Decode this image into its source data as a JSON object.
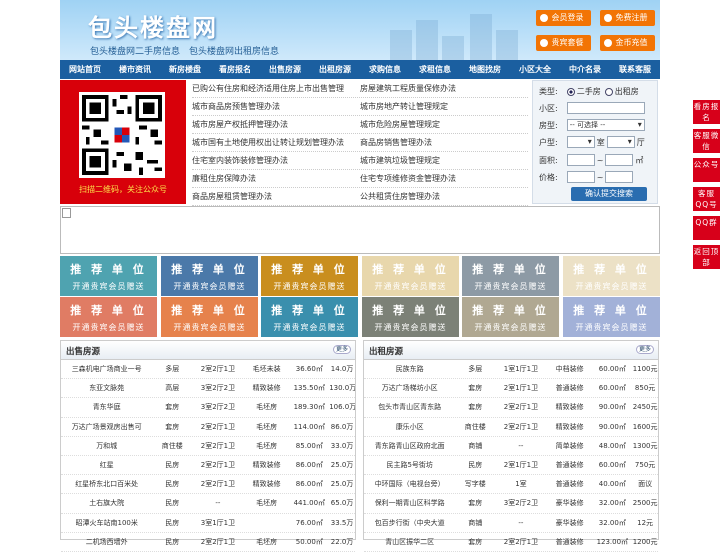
{
  "header": {
    "title": "包头楼盘网",
    "subtitle": "包头楼盘网二手房信息　包头楼盘网出租房信息",
    "buttons": [
      {
        "label": "会员登录"
      },
      {
        "label": "免费注册"
      },
      {
        "label": "贵宾套餐"
      },
      {
        "label": "金币充值"
      }
    ]
  },
  "nav": [
    "网站首页",
    "楼市资讯",
    "新房楼盘",
    "看房报名",
    "出售房源",
    "出租房源",
    "求购信息",
    "求租信息",
    "地图找房",
    "小区大全",
    "中介名录",
    "联系客服"
  ],
  "qr": {
    "caption": "扫描二维码，关注公众号"
  },
  "links": [
    [
      "已购公有住房和经济适用住房上市出售管理",
      "房屋建筑工程质量保修办法"
    ],
    [
      "城市商品房预售管理办法",
      "城市房地产转让管理规定"
    ],
    [
      "城市房屋产权抵押管理办法",
      "城市危险房屋管理规定"
    ],
    [
      "城市国有土地使用权出让转让规划管理办法",
      "商品房销售管理办法"
    ],
    [
      "住宅室内装饰装修管理办法",
      "城市建筑垃圾管理规定"
    ],
    [
      "廉租住房保障办法",
      "住宅专项维修资金管理办法"
    ],
    [
      "商品房屋租赁管理办法",
      "公共租赁住房管理办法"
    ]
  ],
  "search": {
    "type_label": "类型:",
    "type_options": [
      "二手房",
      "出租房"
    ],
    "community_label": "小区:",
    "housetype_label": "房型:",
    "housetype_value": "-- 可选择 --",
    "layout_label": "户型:",
    "unit_room": "室",
    "unit_hall": "厅",
    "area_label": "面积:",
    "area_unit": "㎡",
    "price_label": "价格:",
    "range_sep": "~",
    "submit": "确认提交搜索"
  },
  "recommend": {
    "title": "推 荐 单 位",
    "sub": "开通贵宾会员赠送",
    "colors": [
      "#4fa3b0",
      "#4b79a9",
      "#c98e1e",
      "#e8d7ac",
      "#8d9aa5",
      "#ece1c6",
      "#e07c64",
      "#e6824c",
      "#3a8fad",
      "#7c8177",
      "#b0a892",
      "#a2b1d8"
    ]
  },
  "sale": {
    "title": "出售房源",
    "more": "更多",
    "rows": [
      [
        "三森机电广场商业一号",
        "多层",
        "2室2厅1卫",
        "毛坯未装",
        "36.60㎡",
        "14.0万"
      ],
      [
        "东亚文脉苑",
        "高层",
        "3室2厅2卫",
        "精致装修",
        "135.50㎡",
        "130.0万"
      ],
      [
        "青东华庭",
        "套房",
        "3室2厅2卫",
        "毛坯房",
        "189.30㎡",
        "106.0万"
      ],
      [
        "万达广场景观房出售可",
        "套房",
        "2室2厅1卫",
        "毛坯房",
        "114.00㎡",
        "86.0万"
      ],
      [
        "万和城",
        "商住楼",
        "2室2厅1卫",
        "毛坯房",
        "85.00㎡",
        "33.0万"
      ],
      [
        "红星",
        "民房",
        "2室2厅1卫",
        "精致装修",
        "86.00㎡",
        "25.0万"
      ],
      [
        "红星桥东北口百米处",
        "民房",
        "2室2厅1卫",
        "精致装修",
        "86.00㎡",
        "25.0万"
      ],
      [
        "土右旗大院",
        "民房",
        "--",
        "毛坯房",
        "441.00㎡",
        "65.0万"
      ],
      [
        "昭潭火车站南100米",
        "民房",
        "3室1厅1卫",
        "",
        "76.00㎡",
        "33.5万"
      ],
      [
        "二机场西墙外",
        "民房",
        "2室2厅1卫",
        "毛坯房",
        "50.00㎡",
        "22.0万"
      ]
    ]
  },
  "rent": {
    "title": "出租房源",
    "more": "更多",
    "rows": [
      [
        "民族东路",
        "多层",
        "1室1厅1卫",
        "中档装修",
        "60.00㎡",
        "1100元"
      ],
      [
        "万达广场梯坊小区",
        "套房",
        "2室1厅1卫",
        "普通装修",
        "60.00㎡",
        "850元"
      ],
      [
        "包头市青山区青东路",
        "套房",
        "2室2厅1卫",
        "精致装修",
        "90.00㎡",
        "2450元"
      ],
      [
        "康乐小区",
        "商住楼",
        "2室2厅1卫",
        "精致装修",
        "90.00㎡",
        "1600元"
      ],
      [
        "青东路青山区政府北面",
        "商铺",
        "--",
        "简单装修",
        "48.00㎡",
        "1300元"
      ],
      [
        "民主路5号街坊",
        "民房",
        "2室1厅1卫",
        "普通装修",
        "60.00㎡",
        "750元"
      ],
      [
        "中环国际（电视台旁）",
        "写字楼",
        "1室",
        "普通装修",
        "40.00㎡",
        "面议"
      ],
      [
        "保利一期青山区科学路",
        "套房",
        "3室2厅2卫",
        "豪华装修",
        "32.00㎡",
        "2500元"
      ],
      [
        "包百步行街（中央大道",
        "商铺",
        "--",
        "豪华装修",
        "32.00㎡",
        "12元"
      ],
      [
        "青山区振华二区",
        "套房",
        "2室2厅1卫",
        "普通装修",
        "123.00㎡",
        "1200元"
      ]
    ]
  },
  "side": [
    "看房报名",
    "客服微信",
    "公众号",
    "客服QQ号",
    "QQ群",
    "返回顶部"
  ]
}
